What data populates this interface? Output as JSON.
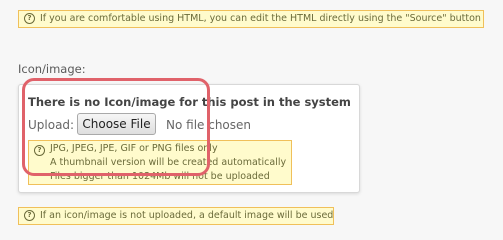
{
  "hints": {
    "top": "If you are comfortable using HTML, you can edit the HTML directly using the \"Source\" button",
    "upload": [
      "JPG, JPEG, JPE, GIF or PNG files only",
      "A thumbnail version will be created automatically",
      "Files bigger than 1024Mb will not be uploaded"
    ],
    "bottom": "If an icon/image is not uploaded, a default image will be used."
  },
  "section": {
    "label": "Icon/image:"
  },
  "panel": {
    "title": "There is no Icon/image for this post in the system",
    "upload_label": "Upload:",
    "choose_file_label": "Choose File",
    "no_file_text": "No file chosen"
  },
  "icons": {
    "info": "info-circle-icon"
  },
  "colors": {
    "hint_bg": "#fffbcc",
    "hint_border": "#f0c05a",
    "highlight": "#e0626a"
  }
}
